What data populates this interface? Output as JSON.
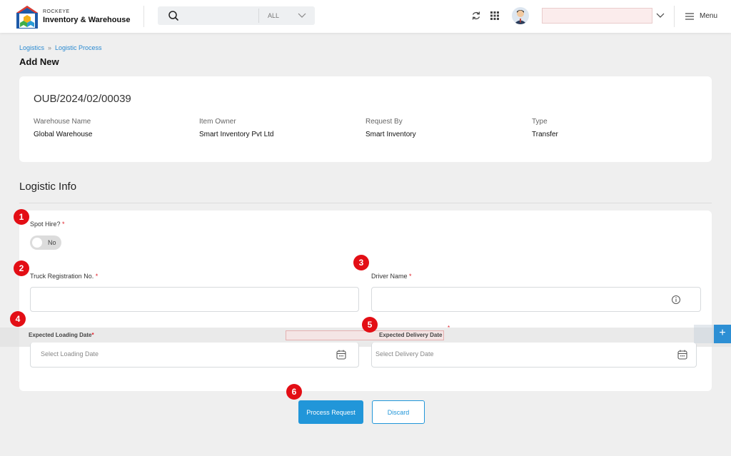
{
  "header": {
    "brand_small": "ROCKEYE",
    "brand_title": "Inventory & Warehouse",
    "search": {
      "scope": "ALL"
    },
    "menu_label": "Menu"
  },
  "breadcrumb": {
    "items": [
      "Logistics",
      "Logistic Process"
    ]
  },
  "page_title": "Add New",
  "summary": {
    "order_id": "OUB/2024/02/00039",
    "fields": [
      {
        "label": "Warehouse Name",
        "value": "Global Warehouse"
      },
      {
        "label": "Item Owner",
        "value": "Smart Inventory Pvt Ltd"
      },
      {
        "label": "Request By",
        "value": "Smart Inventory"
      },
      {
        "label": "Type",
        "value": "Transfer"
      }
    ]
  },
  "logistic_info": {
    "title": "Logistic Info",
    "spot_hire": {
      "label": "Spot Hire?",
      "required": "*",
      "value": "No"
    },
    "truck_registration": {
      "label": "Truck Registration No.",
      "required": "*",
      "value": ""
    },
    "driver_name": {
      "label": "Driver Name",
      "required": "*",
      "value": ""
    },
    "expected_loading_date": {
      "label": "Expected Loading Date",
      "required": "*",
      "placeholder": "Select Loading Date"
    },
    "expected_delivery_date": {
      "label": "Expected Delivery Date",
      "required": "*",
      "placeholder": "Select Delivery Date"
    }
  },
  "badges": [
    "1",
    "2",
    "3",
    "4",
    "5",
    "6"
  ],
  "actions": {
    "process": "Process Request",
    "discard": "Discard",
    "fab": "+"
  },
  "colors": {
    "primary": "#2196d9",
    "badge": "#e30e15",
    "required": "#e0202a"
  }
}
